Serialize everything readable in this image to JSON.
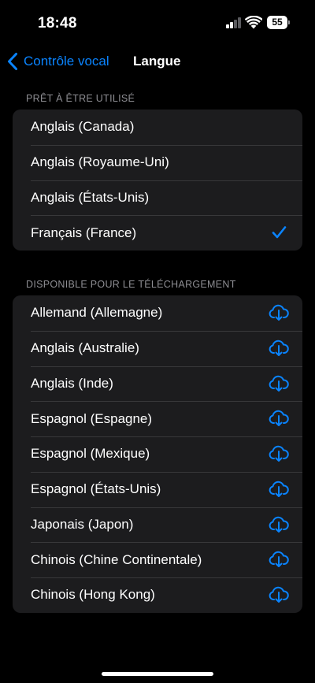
{
  "status_bar": {
    "time": "18:48",
    "battery": "55"
  },
  "nav": {
    "back_label": "Contrôle vocal",
    "title": "Langue"
  },
  "ready_section": {
    "header": "PRÊT À ÊTRE UTILISÉ",
    "items": [
      {
        "label": "Anglais (Canada)",
        "selected": false
      },
      {
        "label": "Anglais (Royaume-Uni)",
        "selected": false
      },
      {
        "label": "Anglais (États-Unis)",
        "selected": false
      },
      {
        "label": "Français (France)",
        "selected": true
      }
    ]
  },
  "download_section": {
    "header": "DISPONIBLE POUR LE TÉLÉCHARGEMENT",
    "items": [
      {
        "label": "Allemand (Allemagne)"
      },
      {
        "label": "Anglais (Australie)"
      },
      {
        "label": "Anglais (Inde)"
      },
      {
        "label": "Espagnol (Espagne)"
      },
      {
        "label": "Espagnol (Mexique)"
      },
      {
        "label": "Espagnol (États-Unis)"
      },
      {
        "label": "Japonais (Japon)"
      },
      {
        "label": "Chinois (Chine Continentale)"
      },
      {
        "label": "Chinois (Hong Kong)"
      }
    ]
  },
  "colors": {
    "accent": "#0a84ff",
    "background": "#000000",
    "group_bg": "#1c1c1e",
    "secondary_text": "#8e8e93"
  },
  "icons": {
    "check": "checkmark-icon",
    "download": "icloud-download-icon",
    "back": "chevron-left-icon"
  }
}
